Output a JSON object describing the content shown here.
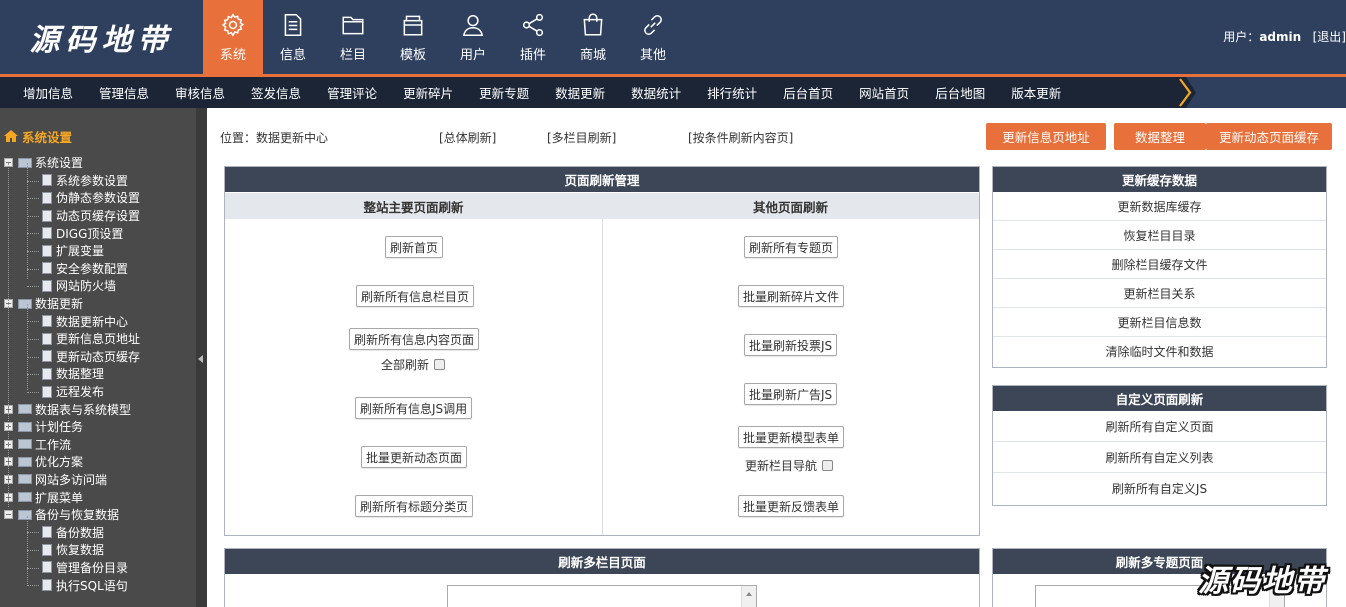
{
  "header": {
    "logo": "源码地带",
    "nav": [
      {
        "label": "系统",
        "icon": "gear-icon"
      },
      {
        "label": "信息",
        "icon": "document-icon"
      },
      {
        "label": "栏目",
        "icon": "folder-icon"
      },
      {
        "label": "模板",
        "icon": "box-icon"
      },
      {
        "label": "用户",
        "icon": "user-icon"
      },
      {
        "label": "插件",
        "icon": "share-icon"
      },
      {
        "label": "商城",
        "icon": "shopping-bag-icon"
      },
      {
        "label": "其他",
        "icon": "link-icon"
      }
    ],
    "user_prefix": "用户：",
    "username": "admin",
    "logout": "[退出]"
  },
  "subnav": [
    "增加信息",
    "管理信息",
    "审核信息",
    "签发信息",
    "管理评论",
    "更新碎片",
    "更新专题",
    "数据更新",
    "数据统计",
    "排行统计",
    "后台首页",
    "网站首页",
    "后台地图",
    "版本更新"
  ],
  "sidebar": {
    "title": "系统设置",
    "groups": [
      {
        "label": "系统设置",
        "expanded": true,
        "children": [
          "系统参数设置",
          "伪静态参数设置",
          "动态页缓存设置",
          "DIGG顶设置",
          "扩展变量",
          "安全参数配置",
          "网站防火墙"
        ]
      },
      {
        "label": "数据更新",
        "expanded": true,
        "children": [
          "数据更新中心",
          "更新信息页地址",
          "更新动态页缓存",
          "数据整理",
          "远程发布"
        ]
      },
      {
        "label": "数据表与系统模型",
        "expanded": false,
        "children": []
      },
      {
        "label": "计划任务",
        "expanded": false,
        "children": []
      },
      {
        "label": "工作流",
        "expanded": false,
        "children": []
      },
      {
        "label": "优化方案",
        "expanded": false,
        "children": []
      },
      {
        "label": "网站多访问端",
        "expanded": false,
        "children": []
      },
      {
        "label": "扩展菜单",
        "expanded": false,
        "children": []
      },
      {
        "label": "备份与恢复数据",
        "expanded": true,
        "children": [
          "备份数据",
          "恢复数据",
          "管理备份目录",
          "执行SQL语句"
        ]
      }
    ]
  },
  "content": {
    "location": "位置：数据更新中心",
    "links": [
      "[总体刷新]",
      "[多栏目刷新]",
      "[按条件刷新内容页]"
    ],
    "action_buttons": [
      "更新信息页地址",
      "数据整理",
      "更新动态页面缓存"
    ],
    "refresh_panel": {
      "title": "页面刷新管理",
      "left_header": "整站主要页面刷新",
      "right_header": "其他页面刷新",
      "left_buttons": [
        "刷新首页",
        "刷新所有信息栏目页",
        "刷新所有信息内容页面",
        "刷新所有信息JS调用",
        "批量更新动态页面",
        "刷新所有标题分类页"
      ],
      "left_checkbox": "全部刷新",
      "right_buttons": [
        "刷新所有专题页",
        "批量刷新碎片文件",
        "批量刷新投票JS",
        "批量刷新广告JS",
        "批量更新模型表单",
        "批量更新反馈表单"
      ],
      "right_checkbox": "更新栏目导航"
    },
    "cache_panel": {
      "title": "更新缓存数据",
      "items": [
        "更新数据库缓存",
        "恢复栏目目录",
        "删除栏目缓存文件",
        "更新栏目关系",
        "更新栏目信息数",
        "清除临时文件和数据"
      ]
    },
    "custom_panel": {
      "title": "自定义页面刷新",
      "items": [
        "刷新所有自定义页面",
        "刷新所有自定义列表",
        "刷新所有自定义JS"
      ]
    },
    "multi_column_panel": {
      "title": "刷新多栏目页面"
    },
    "multi_topic_panel": {
      "title": "刷新多专题页面"
    }
  },
  "watermark": "源码地带",
  "colors": {
    "accent": "#e8703a",
    "header_bg": "#2f3f5e",
    "subnav_bg": "#1b2536",
    "sidebar_bg": "#4a4a4a",
    "panel_header": "#3c4656"
  }
}
